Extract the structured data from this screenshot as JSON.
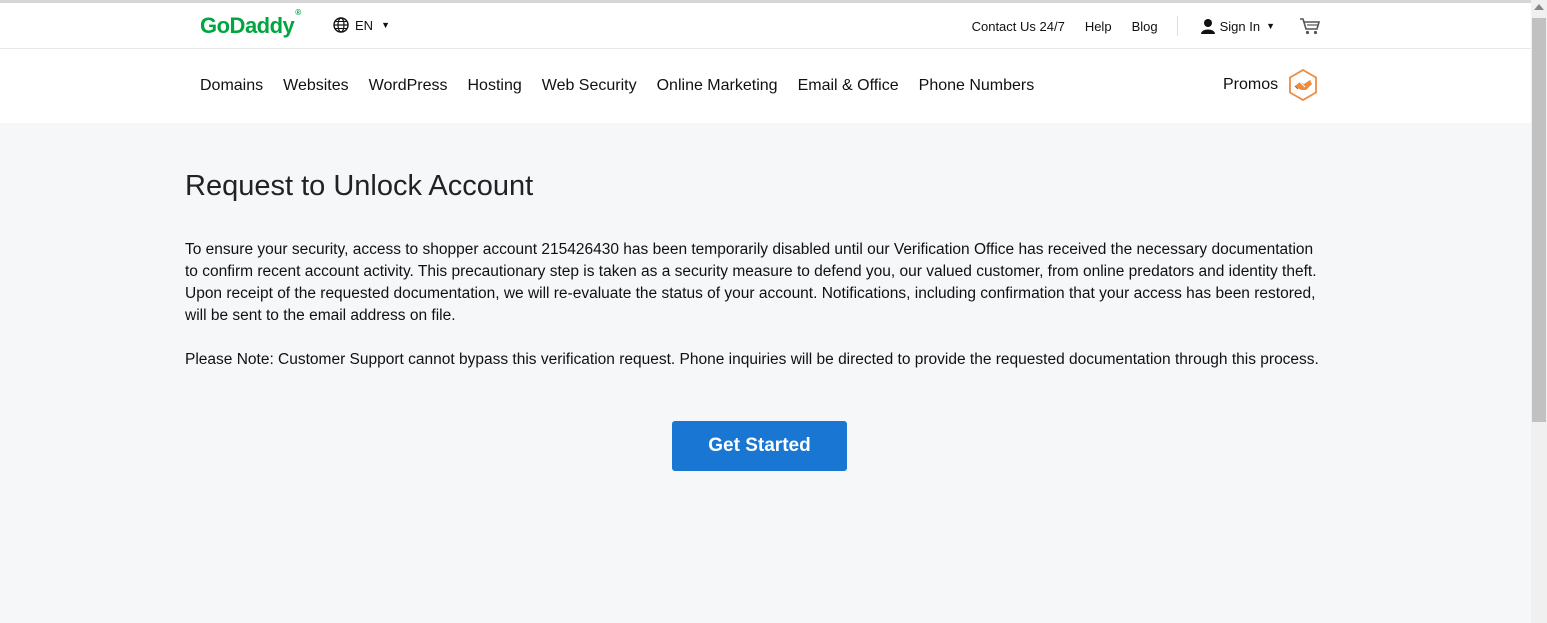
{
  "header": {
    "logo": "GoDaddy",
    "language": "EN",
    "links": {
      "contact": "Contact Us 24/7",
      "help": "Help",
      "blog": "Blog",
      "signin": "Sign In"
    }
  },
  "nav": {
    "items": [
      "Domains",
      "Websites",
      "WordPress",
      "Hosting",
      "Web Security",
      "Online Marketing",
      "Email & Office",
      "Phone Numbers"
    ],
    "promos": "Promos"
  },
  "main": {
    "title": "Request to Unlock Account",
    "paragraph": "To ensure your security, access to shopper account 215426430 has been temporarily disabled until our Verification Office has received the necessary documentation to confirm recent account activity. This precautionary step is taken as a security measure to defend you, our valued customer, from online predators and identity theft. Upon receipt of the requested documentation, we will re-evaluate the status of your account. Notifications, including confirmation that your access has been restored, will be sent to the email address on file.",
    "note": "Please Note: Customer Support cannot bypass this verification request. Phone inquiries will be directed to provide the requested documentation through this process.",
    "cta": "Get Started"
  },
  "colors": {
    "brand_green": "#00a63f",
    "cta_blue": "#1976d2",
    "page_bg": "#f5f7f8"
  },
  "icons": [
    "globe-icon",
    "caret-down-icon",
    "user-icon",
    "cart-icon",
    "promos-handshake-icon"
  ]
}
